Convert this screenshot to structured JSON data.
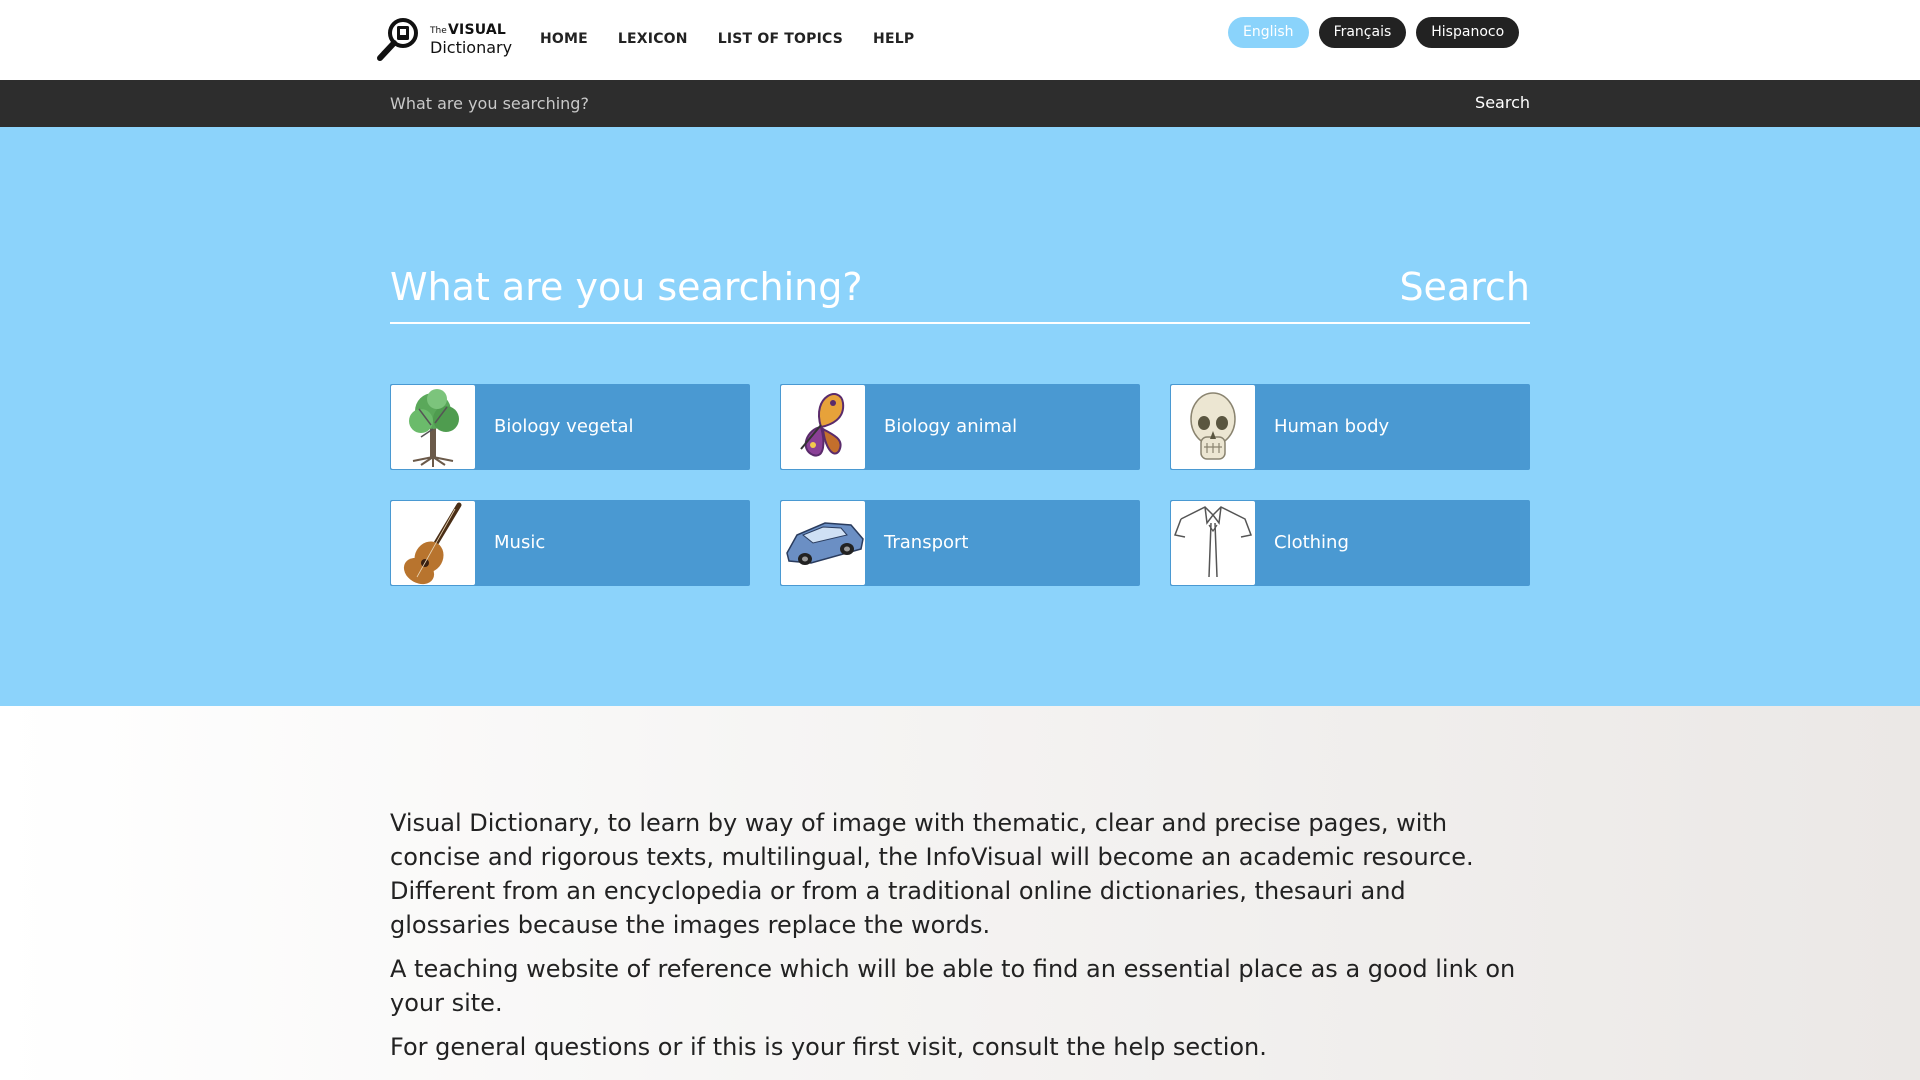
{
  "header": {
    "logo": {
      "small": "The",
      "bold": "VISUAL",
      "word": "Dictionary"
    },
    "nav": [
      "HOME",
      "LEXICON",
      "LIST OF TOPICS",
      "HELP"
    ],
    "languages": [
      {
        "label": "English",
        "active": true
      },
      {
        "label": "Français",
        "active": false
      },
      {
        "label": "Hispanoco",
        "active": false
      }
    ]
  },
  "topbar": {
    "placeholder": "What are you searching?",
    "button": "Search"
  },
  "hero": {
    "placeholder": "What are you searching?",
    "button": "Search",
    "tiles": [
      {
        "label": "Biology vegetal",
        "icon": "tree-icon"
      },
      {
        "label": "Biology animal",
        "icon": "butterfly-icon"
      },
      {
        "label": "Human body",
        "icon": "skull-icon"
      },
      {
        "label": "Music",
        "icon": "guitar-icon"
      },
      {
        "label": "Transport",
        "icon": "car-icon"
      },
      {
        "label": "Clothing",
        "icon": "shirt-icon"
      }
    ]
  },
  "intro": {
    "paragraphs": [
      "Visual Dictionary, to learn by way of image with thematic, clear and precise pages, with concise and rigorous texts, multilingual, the InfoVisual will become an academic resource. Different from an encyclopedia or from a traditional online dictionaries, thesauri and glossaries because the images replace the words.",
      "A teaching website of reference which will be able to find an essential place as a good link on your site.",
      "For general questions or if this is your first visit, consult the help section."
    ]
  },
  "colors": {
    "hero_bg": "#8cd3fb",
    "tile_bg": "#4a99d2",
    "darkbar_bg": "#2d2d2d",
    "active_lang": "#8ad3fb"
  }
}
